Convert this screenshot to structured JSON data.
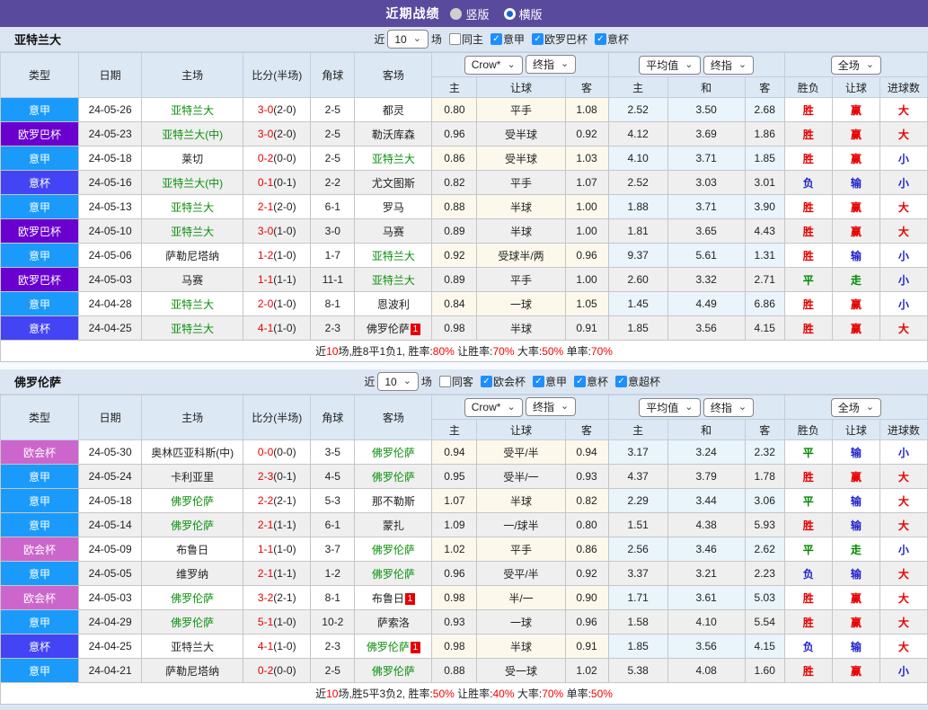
{
  "header": {
    "title": "近期战绩",
    "view_options": [
      {
        "label": "竖版",
        "selected": false
      },
      {
        "label": "横版",
        "selected": true
      }
    ]
  },
  "colors": {
    "topbar": "#5a4a9e",
    "accent_red": "#e60000",
    "accent_blue": "#2323cc",
    "accent_green": "#008800",
    "focus_team_green": "#0b8f0b",
    "type_colors": {
      "意甲": "#1a9bfc",
      "欧罗巴杯": "#6a00d0",
      "意杯": "#4444f4",
      "欧会杯": "#cc66cc"
    },
    "result_colors": {
      "胜": "#e60000",
      "平": "#008800",
      "负": "#2323cc",
      "赢": "#e60000",
      "走": "#008800",
      "输": "#2323cc",
      "大": "#e60000",
      "小": "#2323cc"
    }
  },
  "columns": {
    "left": [
      "类型",
      "日期",
      "主场",
      "比分(半场)",
      "角球",
      "客场"
    ],
    "handicap": [
      "主",
      "让球",
      "客"
    ],
    "euro": [
      "主",
      "和",
      "客"
    ],
    "result": [
      "胜负",
      "让球",
      "进球数"
    ]
  },
  "sections": [
    {
      "team": "亚特兰大",
      "filter": {
        "near_label": "近",
        "count": "10",
        "unit_label": "场",
        "same": {
          "label": "同主",
          "checked": false
        },
        "leagues": [
          {
            "label": "意甲",
            "checked": true
          },
          {
            "label": "欧罗巴杯",
            "checked": true
          },
          {
            "label": "意杯",
            "checked": true
          }
        ]
      },
      "selectors": {
        "handicap": [
          "Crow*",
          "终指"
        ],
        "euro": [
          "平均值",
          "终指"
        ],
        "scope": "全场"
      },
      "rows": [
        {
          "type": "意甲",
          "date": "24-05-26",
          "home": "亚特兰大",
          "home_focus": true,
          "score": "3-0",
          "half": "(2-0)",
          "corner": "2-5",
          "away": "都灵",
          "away_focus": false,
          "let": [
            "0.80",
            "平手",
            "1.08"
          ],
          "euro": [
            "2.52",
            "3.50",
            "2.68"
          ],
          "results": [
            "胜",
            "赢",
            "大"
          ]
        },
        {
          "type": "欧罗巴杯",
          "date": "24-05-23",
          "home": "亚特兰大(中)",
          "home_focus": true,
          "score": "3-0",
          "half": "(2-0)",
          "corner": "2-5",
          "away": "勒沃库森",
          "away_focus": false,
          "let": [
            "0.96",
            "受半球",
            "0.92"
          ],
          "euro": [
            "4.12",
            "3.69",
            "1.86"
          ],
          "results": [
            "胜",
            "赢",
            "大"
          ]
        },
        {
          "type": "意甲",
          "date": "24-05-18",
          "home": "莱切",
          "home_focus": false,
          "score": "0-2",
          "half": "(0-0)",
          "corner": "2-5",
          "away": "亚特兰大",
          "away_focus": true,
          "let": [
            "0.86",
            "受半球",
            "1.03"
          ],
          "euro": [
            "4.10",
            "3.71",
            "1.85"
          ],
          "results": [
            "胜",
            "赢",
            "小"
          ]
        },
        {
          "type": "意杯",
          "date": "24-05-16",
          "home": "亚特兰大(中)",
          "home_focus": true,
          "score": "0-1",
          "half": "(0-1)",
          "corner": "2-2",
          "away": "尤文图斯",
          "away_focus": false,
          "let": [
            "0.82",
            "平手",
            "1.07"
          ],
          "euro": [
            "2.52",
            "3.03",
            "3.01"
          ],
          "results": [
            "负",
            "输",
            "小"
          ]
        },
        {
          "type": "意甲",
          "date": "24-05-13",
          "home": "亚特兰大",
          "home_focus": true,
          "score": "2-1",
          "half": "(2-0)",
          "corner": "6-1",
          "away": "罗马",
          "away_focus": false,
          "let": [
            "0.88",
            "半球",
            "1.00"
          ],
          "euro": [
            "1.88",
            "3.71",
            "3.90"
          ],
          "results": [
            "胜",
            "赢",
            "大"
          ]
        },
        {
          "type": "欧罗巴杯",
          "date": "24-05-10",
          "home": "亚特兰大",
          "home_focus": true,
          "score": "3-0",
          "half": "(1-0)",
          "corner": "3-0",
          "away": "马赛",
          "away_focus": false,
          "let": [
            "0.89",
            "半球",
            "1.00"
          ],
          "euro": [
            "1.81",
            "3.65",
            "4.43"
          ],
          "results": [
            "胜",
            "赢",
            "大"
          ]
        },
        {
          "type": "意甲",
          "date": "24-05-06",
          "home": "萨勒尼塔纳",
          "home_focus": false,
          "score": "1-2",
          "half": "(1-0)",
          "corner": "1-7",
          "away": "亚特兰大",
          "away_focus": true,
          "let": [
            "0.92",
            "受球半/两",
            "0.96"
          ],
          "euro": [
            "9.37",
            "5.61",
            "1.31"
          ],
          "results": [
            "胜",
            "输",
            "小"
          ]
        },
        {
          "type": "欧罗巴杯",
          "date": "24-05-03",
          "home": "马赛",
          "home_focus": false,
          "score": "1-1",
          "half": "(1-1)",
          "corner": "11-1",
          "away": "亚特兰大",
          "away_focus": true,
          "let": [
            "0.89",
            "平手",
            "1.00"
          ],
          "euro": [
            "2.60",
            "3.32",
            "2.71"
          ],
          "results": [
            "平",
            "走",
            "小"
          ]
        },
        {
          "type": "意甲",
          "date": "24-04-28",
          "home": "亚特兰大",
          "home_focus": true,
          "score": "2-0",
          "half": "(1-0)",
          "corner": "8-1",
          "away": "恩波利",
          "away_focus": false,
          "let": [
            "0.84",
            "一球",
            "1.05"
          ],
          "euro": [
            "1.45",
            "4.49",
            "6.86"
          ],
          "results": [
            "胜",
            "赢",
            "小"
          ]
        },
        {
          "type": "意杯",
          "date": "24-04-25",
          "home": "亚特兰大",
          "home_focus": true,
          "score": "4-1",
          "half": "(1-0)",
          "corner": "2-3",
          "away": "佛罗伦萨",
          "away_focus": false,
          "away_badge": "1",
          "let": [
            "0.98",
            "半球",
            "0.91"
          ],
          "euro": [
            "1.85",
            "3.56",
            "4.15"
          ],
          "results": [
            "胜",
            "赢",
            "大"
          ]
        }
      ],
      "summary": [
        {
          "t": "近"
        },
        {
          "t": "10",
          "red": true
        },
        {
          "t": "场,胜8平1负1, 胜率:"
        },
        {
          "t": "80%",
          "red": true
        },
        {
          "t": " 让胜率:"
        },
        {
          "t": "70%",
          "red": true
        },
        {
          "t": " 大率:"
        },
        {
          "t": "50%",
          "red": true
        },
        {
          "t": " 单率:"
        },
        {
          "t": "70%",
          "red": true
        }
      ]
    },
    {
      "team": "佛罗伦萨",
      "filter": {
        "near_label": "近",
        "count": "10",
        "unit_label": "场",
        "same": {
          "label": "同客",
          "checked": false
        },
        "leagues": [
          {
            "label": "欧会杯",
            "checked": true
          },
          {
            "label": "意甲",
            "checked": true
          },
          {
            "label": "意杯",
            "checked": true
          },
          {
            "label": "意超杯",
            "checked": true
          }
        ]
      },
      "selectors": {
        "handicap": [
          "Crow*",
          "终指"
        ],
        "euro": [
          "平均值",
          "终指"
        ],
        "scope": "全场"
      },
      "rows": [
        {
          "type": "欧会杯",
          "date": "24-05-30",
          "home": "奥林匹亚科斯(中)",
          "home_focus": false,
          "score": "0-0",
          "half": "(0-0)",
          "corner": "3-5",
          "away": "佛罗伦萨",
          "away_focus": true,
          "let": [
            "0.94",
            "受平/半",
            "0.94"
          ],
          "euro": [
            "3.17",
            "3.24",
            "2.32"
          ],
          "results": [
            "平",
            "输",
            "小"
          ]
        },
        {
          "type": "意甲",
          "date": "24-05-24",
          "home": "卡利亚里",
          "home_focus": false,
          "score": "2-3",
          "half": "(0-1)",
          "corner": "4-5",
          "away": "佛罗伦萨",
          "away_focus": true,
          "let": [
            "0.95",
            "受半/一",
            "0.93"
          ],
          "euro": [
            "4.37",
            "3.79",
            "1.78"
          ],
          "results": [
            "胜",
            "赢",
            "大"
          ]
        },
        {
          "type": "意甲",
          "date": "24-05-18",
          "home": "佛罗伦萨",
          "home_focus": true,
          "score": "2-2",
          "half": "(2-1)",
          "corner": "5-3",
          "away": "那不勒斯",
          "away_focus": false,
          "let": [
            "1.07",
            "半球",
            "0.82"
          ],
          "euro": [
            "2.29",
            "3.44",
            "3.06"
          ],
          "results": [
            "平",
            "输",
            "大"
          ]
        },
        {
          "type": "意甲",
          "date": "24-05-14",
          "home": "佛罗伦萨",
          "home_focus": true,
          "score": "2-1",
          "half": "(1-1)",
          "corner": "6-1",
          "away": "蒙扎",
          "away_focus": false,
          "let": [
            "1.09",
            "一/球半",
            "0.80"
          ],
          "euro": [
            "1.51",
            "4.38",
            "5.93"
          ],
          "results": [
            "胜",
            "输",
            "大"
          ]
        },
        {
          "type": "欧会杯",
          "date": "24-05-09",
          "home": "布鲁日",
          "home_focus": false,
          "score": "1-1",
          "half": "(1-0)",
          "corner": "3-7",
          "away": "佛罗伦萨",
          "away_focus": true,
          "let": [
            "1.02",
            "平手",
            "0.86"
          ],
          "euro": [
            "2.56",
            "3.46",
            "2.62"
          ],
          "results": [
            "平",
            "走",
            "小"
          ]
        },
        {
          "type": "意甲",
          "date": "24-05-05",
          "home": "维罗纳",
          "home_focus": false,
          "score": "2-1",
          "half": "(1-1)",
          "corner": "1-2",
          "away": "佛罗伦萨",
          "away_focus": true,
          "let": [
            "0.96",
            "受平/半",
            "0.92"
          ],
          "euro": [
            "3.37",
            "3.21",
            "2.23"
          ],
          "results": [
            "负",
            "输",
            "大"
          ]
        },
        {
          "type": "欧会杯",
          "date": "24-05-03",
          "home": "佛罗伦萨",
          "home_focus": true,
          "score": "3-2",
          "half": "(2-1)",
          "corner": "8-1",
          "away": "布鲁日",
          "away_focus": false,
          "away_badge": "1",
          "let": [
            "0.98",
            "半/一",
            "0.90"
          ],
          "euro": [
            "1.71",
            "3.61",
            "5.03"
          ],
          "results": [
            "胜",
            "赢",
            "大"
          ]
        },
        {
          "type": "意甲",
          "date": "24-04-29",
          "home": "佛罗伦萨",
          "home_focus": true,
          "score": "5-1",
          "half": "(1-0)",
          "corner": "10-2",
          "away": "萨索洛",
          "away_focus": false,
          "let": [
            "0.93",
            "一球",
            "0.96"
          ],
          "euro": [
            "1.58",
            "4.10",
            "5.54"
          ],
          "results": [
            "胜",
            "赢",
            "大"
          ]
        },
        {
          "type": "意杯",
          "date": "24-04-25",
          "home": "亚特兰大",
          "home_focus": false,
          "score": "4-1",
          "half": "(1-0)",
          "corner": "2-3",
          "away": "佛罗伦萨",
          "away_focus": true,
          "away_badge": "1",
          "let": [
            "0.98",
            "半球",
            "0.91"
          ],
          "euro": [
            "1.85",
            "3.56",
            "4.15"
          ],
          "results": [
            "负",
            "输",
            "大"
          ]
        },
        {
          "type": "意甲",
          "date": "24-04-21",
          "home": "萨勒尼塔纳",
          "home_focus": false,
          "score": "0-2",
          "half": "(0-0)",
          "corner": "2-5",
          "away": "佛罗伦萨",
          "away_focus": true,
          "let": [
            "0.88",
            "受一球",
            "1.02"
          ],
          "euro": [
            "5.38",
            "4.08",
            "1.60"
          ],
          "results": [
            "胜",
            "赢",
            "小"
          ]
        }
      ],
      "summary": [
        {
          "t": "近"
        },
        {
          "t": "10",
          "red": true
        },
        {
          "t": "场,胜5平3负2, 胜率:"
        },
        {
          "t": "50%",
          "red": true
        },
        {
          "t": " 让胜率:"
        },
        {
          "t": "40%",
          "red": true
        },
        {
          "t": " 大率:"
        },
        {
          "t": "70%",
          "red": true
        },
        {
          "t": " 单率:"
        },
        {
          "t": "50%",
          "red": true
        }
      ]
    }
  ]
}
